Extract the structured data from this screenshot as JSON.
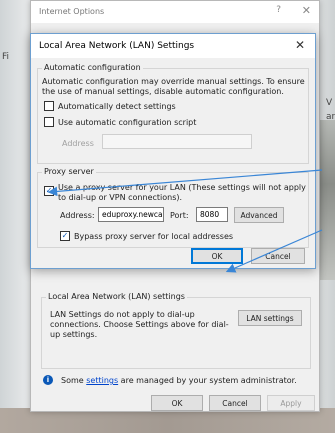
{
  "background": {
    "left_letters": [
      "Fi"
    ],
    "right_letters": [
      "V",
      "ar"
    ]
  },
  "outer_window": {
    "title": "Internet Options",
    "help_glyph": "?",
    "close_glyph": "✕",
    "lan_settings_group": {
      "legend": "Local Area Network (LAN) settings",
      "description": "LAN Settings do not apply to dial-up connections. Choose Settings above for dial-up settings.",
      "button_label": "LAN settings"
    },
    "admin_notice": {
      "prefix": "Some ",
      "link_text": "settings",
      "suffix": " are managed by your system administrator."
    },
    "buttons": {
      "ok": "OK",
      "cancel": "Cancel",
      "apply": "Apply"
    }
  },
  "dialog": {
    "title": "Local Area Network (LAN) Settings",
    "close_glyph": "✕",
    "auto_config": {
      "legend": "Automatic configuration",
      "description": "Automatic configuration may override manual settings.  To ensure the use of manual settings, disable automatic configuration.",
      "auto_detect_label": "Automatically detect settings",
      "auto_detect_checked": false,
      "use_script_label": "Use automatic configuration script",
      "use_script_checked": false,
      "address_label": "Address",
      "address_value": ""
    },
    "proxy": {
      "legend": "Proxy server",
      "use_proxy_label": "Use a proxy server for your LAN (These settings will not apply to dial-up or VPN connections).",
      "use_proxy_checked": true,
      "address_label": "Address:",
      "address_value": "eduproxy.newca",
      "port_label": "Port:",
      "port_value": "8080",
      "advanced_label": "Advanced",
      "bypass_label": "Bypass proxy server for local addresses",
      "bypass_checked": true
    },
    "buttons": {
      "ok": "OK",
      "cancel": "Cancel"
    }
  },
  "check_glyph": "✓",
  "colors": {
    "accent": "#0078d7",
    "annotation_arrow": "#3a86d6"
  }
}
